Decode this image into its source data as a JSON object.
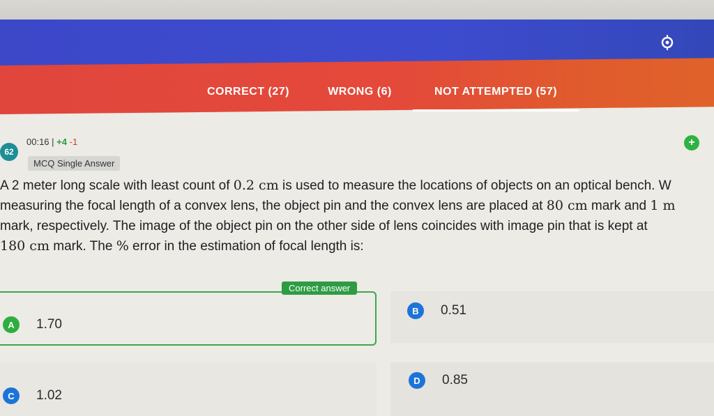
{
  "header": {
    "icons": [
      "target-icon",
      "moon-icon"
    ]
  },
  "tabs": [
    {
      "label": "CORRECT (27)"
    },
    {
      "label": "WRONG (6)"
    },
    {
      "label": "NOT ATTEMPTED (57)"
    }
  ],
  "question": {
    "number": "62",
    "time": "00:16 |",
    "plus_marks": "+4",
    "minus_marks": "-1",
    "type": "MCQ Single Answer",
    "lines": [
      [
        "A 2 meter long scale with least count of ",
        "0.2 cm",
        " is used to measure the locations of objects on an optical bench. W"
      ],
      [
        "measuring the focal length of a convex lens, the object pin and the convex lens are placed at ",
        "80 cm",
        " mark and ",
        "1 m"
      ],
      [
        "mark, respectively. The image of the object pin on the other side of lens coincides with image pin that is kept at"
      ],
      [
        "180 cm",
        " mark. The ",
        "%",
        " error in the estimation of focal length is:"
      ]
    ]
  },
  "correct_label": "Correct answer",
  "options": [
    {
      "letter": "A",
      "value": "1.70",
      "color": "#2eae3e"
    },
    {
      "letter": "B",
      "value": "0.51",
      "color": "#1d74d8"
    },
    {
      "letter": "C",
      "value": "1.02",
      "color": "#1d74d8"
    },
    {
      "letter": "D",
      "value": "0.85",
      "color": "#1d74d8"
    }
  ]
}
